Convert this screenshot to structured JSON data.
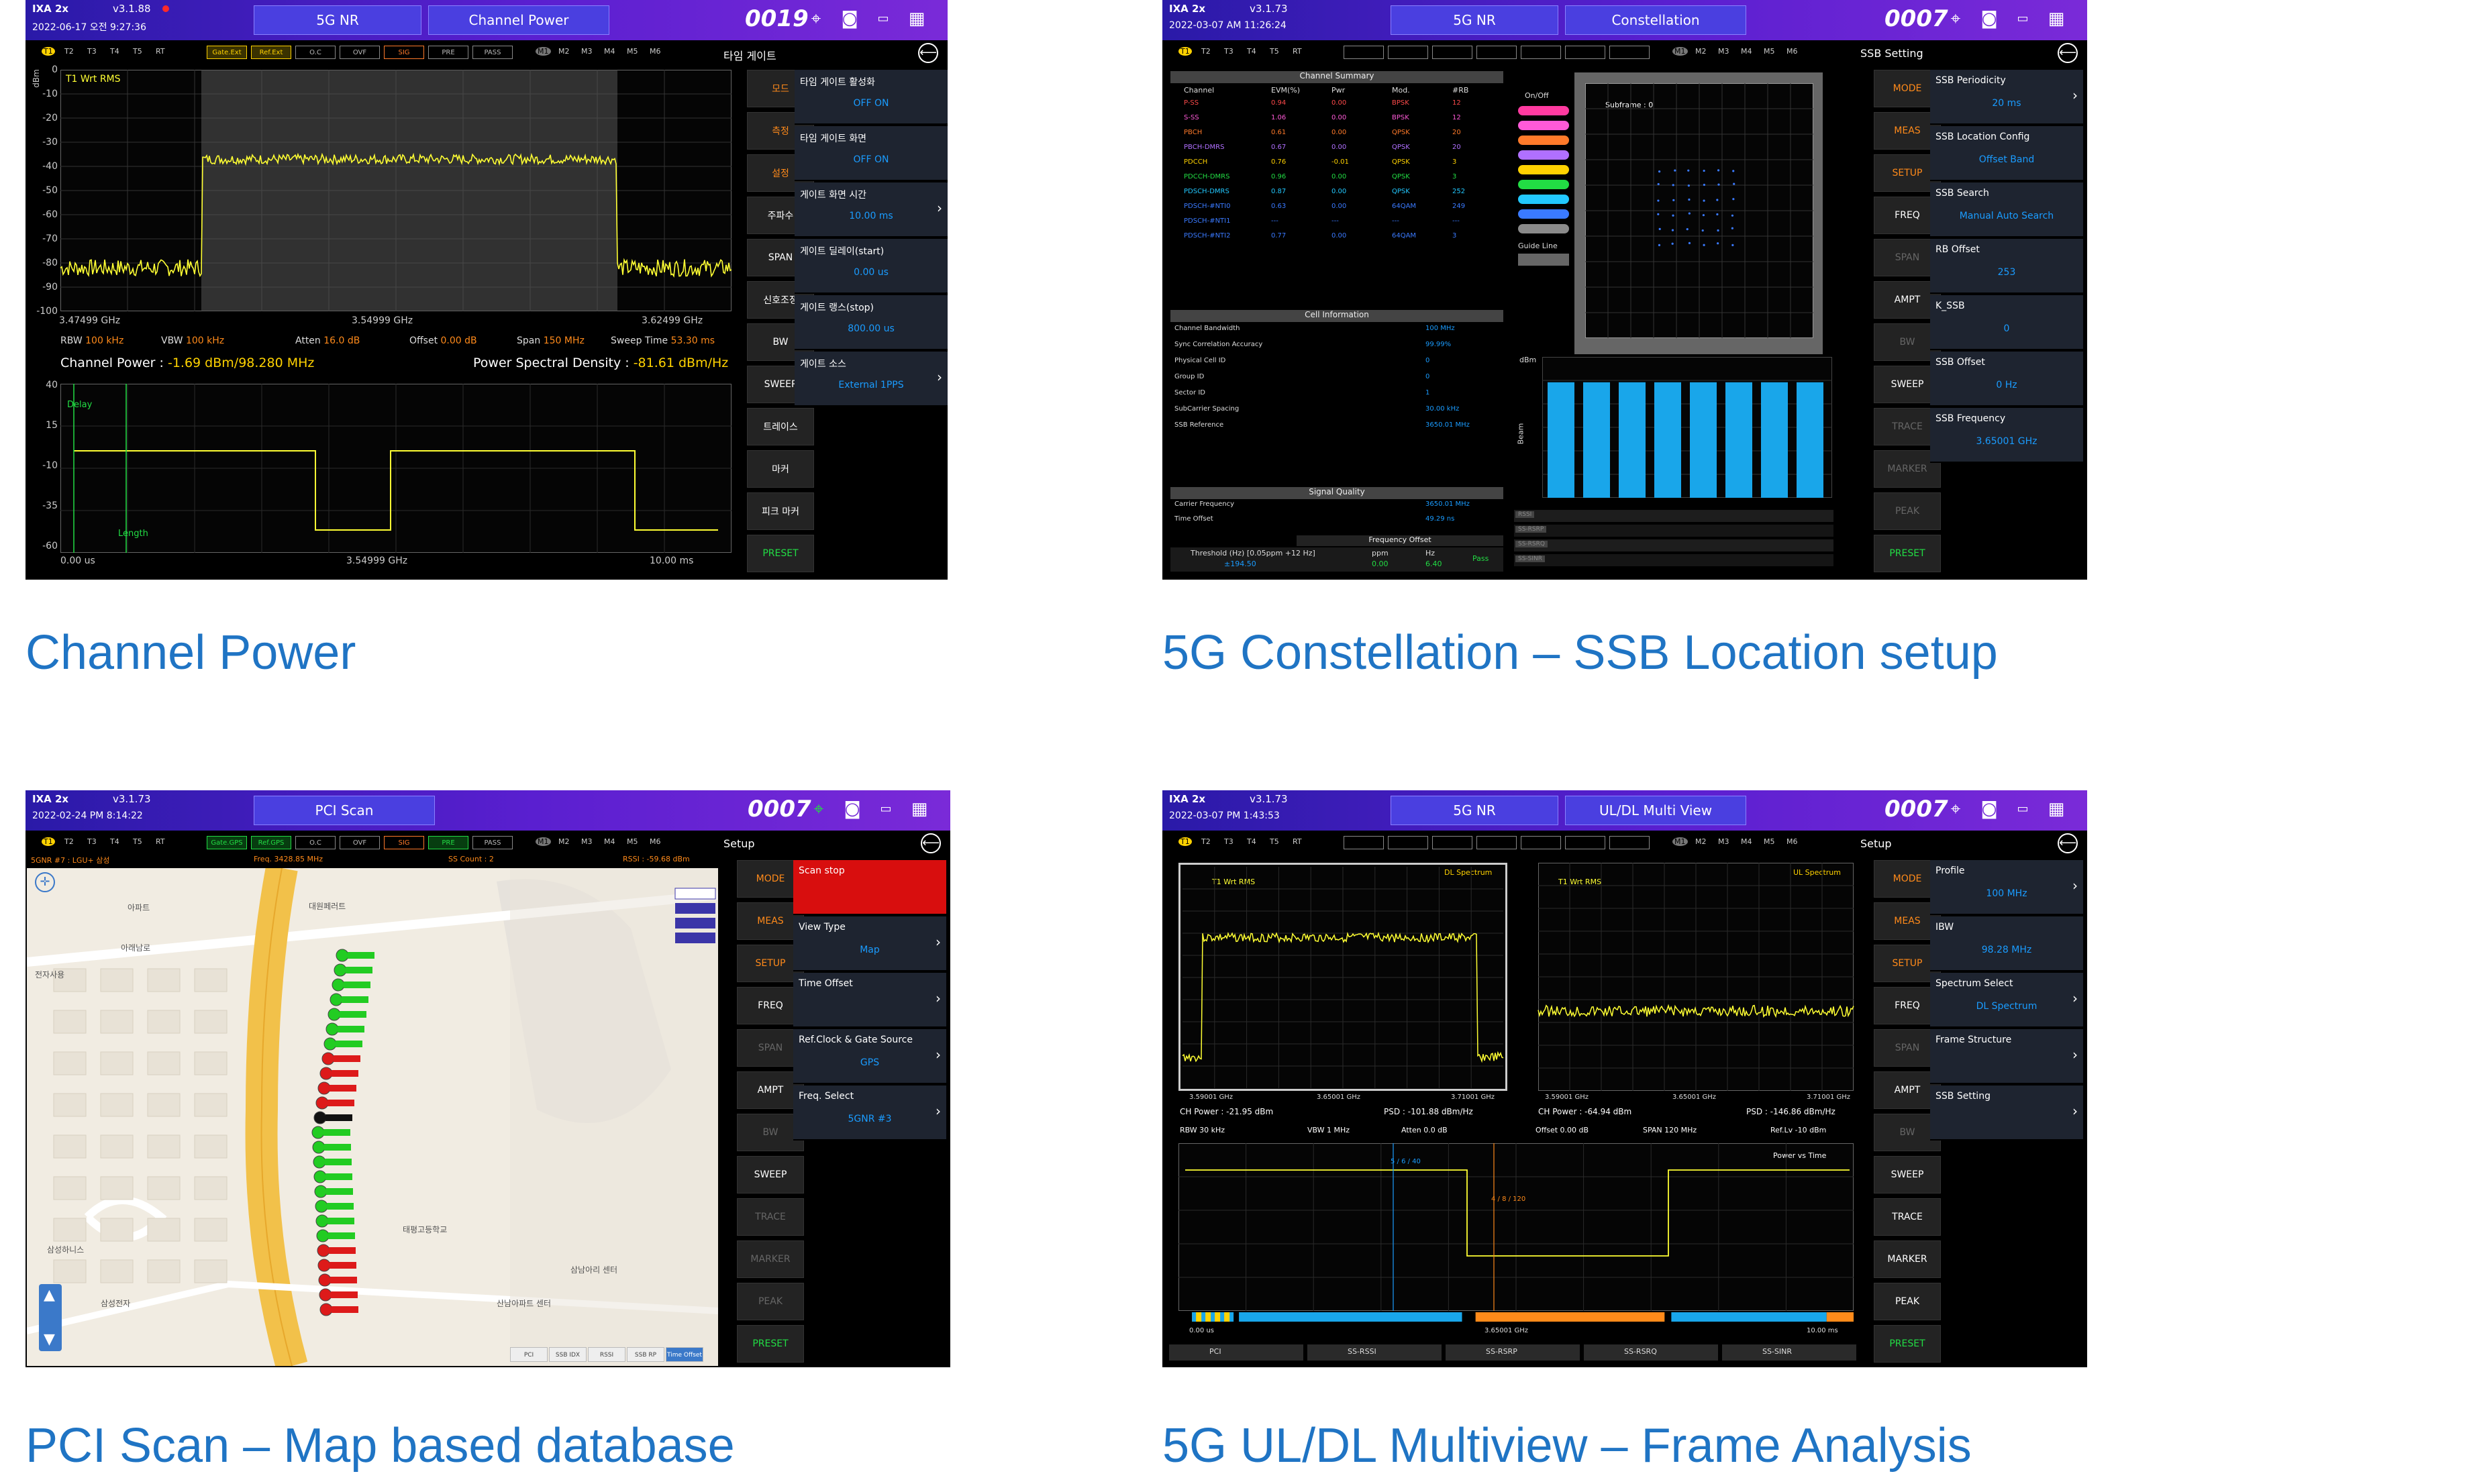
{
  "captions": {
    "p1": "Channel Power",
    "p2": "5G Constellation – SSB  Location setup",
    "p3": "PCI Scan – Map based database",
    "p4": "5G UL/DL Multiview – Frame Analysis"
  },
  "s1": {
    "device": "IXA 2x",
    "version": "v3.1.88",
    "datetime": "2022-06-17 오전 9:27:36",
    "tab_mode": "5G NR",
    "tab_meas": "Channel Power",
    "count": "0019",
    "traces": [
      "T1",
      "T2",
      "T3",
      "T4",
      "T5",
      "RT"
    ],
    "chips": [
      "Gate.Ext",
      "Ref.Ext",
      "O.C",
      "OVF",
      "SIG",
      "PRE",
      "PASS"
    ],
    "markers": [
      "M1",
      "M2",
      "M3",
      "M4",
      "M5",
      "M6"
    ],
    "panel_title": "타임 게이트",
    "trace_label": "T1 Wrt RMS",
    "y_unit": "dBm",
    "y_ticks": [
      "0",
      "-10",
      "-20",
      "-30",
      "-40",
      "-50",
      "-60",
      "-70",
      "-80",
      "-90",
      "-100"
    ],
    "x_start": "3.47499 GHz",
    "x_center": "3.54999 GHz",
    "x_stop": "3.62499 GHz",
    "rbw_l": "RBW",
    "rbw_v": "100 kHz",
    "vbw_l": "VBW",
    "vbw_v": "100 kHz",
    "atten_l": "Atten",
    "atten_v": "16.0 dB",
    "offset_l": "Offset",
    "offset_v": "0.00 dB",
    "span_l": "Span",
    "span_v": "150 MHz",
    "sweep_l": "Sweep Time",
    "sweep_v": "53.30 ms",
    "cp_label": "Channel Power : ",
    "cp_value": "-1.69 dBm/98.280 MHz",
    "psd_label": "Power Spectral Density : ",
    "psd_value": "-81.61 dBm/Hz",
    "y2_ticks": [
      "40",
      "15",
      "-10",
      "-35",
      "-60"
    ],
    "delay_label": "Delay",
    "length_label": "Length",
    "x2_start": "0.00 us",
    "x2_center": "3.54999 GHz",
    "x2_stop": "10.00 ms",
    "side": [
      "모드",
      "측정",
      "설정",
      "주파수",
      "SPAN",
      "신호조정",
      "BW",
      "SWEEP",
      "트레이스",
      "마커",
      "피크 마커",
      "PRESET"
    ],
    "panel": [
      {
        "t": "타임 게이트 활성화",
        "v": "OFF ON"
      },
      {
        "t": "타임 게이트 화면",
        "v": "OFF ON"
      },
      {
        "t": "게이트 화면 시간",
        "v": "10.00 ms"
      },
      {
        "t": "게이트 딜레이(start)",
        "v": "0.00 us"
      },
      {
        "t": "게이트 랭스(stop)",
        "v": "800.00 us"
      },
      {
        "t": "게이트 소스",
        "v": "External 1PPS"
      }
    ]
  },
  "s2": {
    "device": "IXA 2x",
    "version": "v3.1.73",
    "datetime": "2022-03-07 AM 11:26:24",
    "tab_mode": "5G NR",
    "tab_meas": "Constellation",
    "count": "0007",
    "traces": [
      "T1",
      "T2",
      "T3",
      "T4",
      "T5",
      "RT"
    ],
    "markers": [
      "M1",
      "M2",
      "M3",
      "M4",
      "M5",
      "M6"
    ],
    "panel_title": "SSB Setting",
    "summary_title": "Channel Summary",
    "summary_cols": [
      "Channel",
      "EVM(%)",
      "Pwr",
      "Mod.",
      "#RB"
    ],
    "summary_rows": [
      [
        "P-SS",
        "0.94",
        "0.00",
        "BPSK",
        "12"
      ],
      [
        "S-SS",
        "1.06",
        "0.00",
        "BPSK",
        "12"
      ],
      [
        "PBCH",
        "0.61",
        "0.00",
        "QPSK",
        "20"
      ],
      [
        "PBCH-DMRS",
        "0.67",
        "0.00",
        "QPSK",
        "20"
      ],
      [
        "PDCCH",
        "0.76",
        "-0.01",
        "QPSK",
        "3"
      ],
      [
        "PDCCH-DMRS",
        "0.96",
        "0.00",
        "QPSK",
        "3"
      ],
      [
        "PDSCH-DMRS",
        "0.87",
        "0.00",
        "QPSK",
        "252"
      ],
      [
        "PDSCH-#NTI0",
        "0.63",
        "0.00",
        "64QAM",
        "249"
      ],
      [
        "PDSCH-#NTI1",
        "---",
        "---",
        "---",
        "---"
      ],
      [
        "PDSCH-#NTI2",
        "0.77",
        "0.00",
        "64QAM",
        "3"
      ]
    ],
    "onoff": "On/Off",
    "guide_line": "Guide Line",
    "subframe": "Subframe : 0",
    "cell_title": "Cell Information",
    "cell_rows": [
      [
        "Channel Bandwidth",
        "100 MHz"
      ],
      [
        "Sync Correlation Accuracy",
        "99.99%"
      ],
      [
        "Physical Cell ID",
        "0"
      ],
      [
        "Group ID",
        "0"
      ],
      [
        "Sector ID",
        "1"
      ],
      [
        "SubCarrier Spacing",
        "30.00 kHz"
      ],
      [
        "SSB Reference",
        "3650.01 MHz"
      ]
    ],
    "sq_title": "Signal Quality",
    "sq_rows": [
      [
        "Carrier Frequency",
        "3650.01 MHz"
      ],
      [
        "Time Offset",
        "49.29 ns"
      ]
    ],
    "fo_title": "Frequency Offset",
    "fo_threshold": "Threshold (Hz) [0.05ppm +12 Hz]",
    "fo_ppm": "ppm",
    "fo_hz": "Hz",
    "fo_value": "±194.50",
    "fo_ppm_v": "0.00",
    "fo_hz_v": "6.40",
    "fo_pass": "Pass",
    "bar_values": [
      0.82,
      0.82,
      0.82,
      0.82,
      0.82,
      0.82,
      0.82,
      0.82
    ],
    "bars_unit": "dBm",
    "bars_axis": "Beam",
    "side": [
      "MODE",
      "MEAS",
      "SETUP",
      "FREQ",
      "SPAN",
      "AMPT",
      "BW",
      "SWEEP",
      "TRACE",
      "MARKER",
      "PEAK",
      "PRESET"
    ],
    "panel": [
      {
        "t": "SSB Periodicity",
        "v": "20 ms",
        "c": true
      },
      {
        "t": "SSB Location Config",
        "v": "Offset Band",
        "c": false
      },
      {
        "t": "SSB Search",
        "v": "Manual Auto Search",
        "c": false
      },
      {
        "t": "RB Offset",
        "v": "253",
        "c": false
      },
      {
        "t": "K_SSB",
        "v": "0",
        "c": false
      },
      {
        "t": "SSB Offset",
        "v": "0 Hz",
        "c": false
      },
      {
        "t": "SSB Frequency",
        "v": "3.65001 GHz",
        "c": false
      }
    ],
    "bottom_rows": [
      "RSSI",
      "SS-RSRP",
      "SS-RSRQ",
      "SS-SINR"
    ]
  },
  "s3": {
    "device": "IXA 2x",
    "version": "v3.1.73",
    "datetime": "2022-02-24 PM 8:14:22",
    "tab_meas": "PCI Scan",
    "count": "0007",
    "traces": [
      "T1",
      "T2",
      "T3",
      "T4",
      "T5",
      "RT"
    ],
    "chips": [
      "Gate.GPS",
      "Ref.GPS",
      "O.C",
      "OVF",
      "SIG",
      "PRE",
      "PASS"
    ],
    "markers": [
      "M1",
      "M2",
      "M3",
      "M4",
      "M5",
      "M6"
    ],
    "panel_title": "Setup",
    "info_left": "5GNR #7 : LGU+ 삼성",
    "info_freq": "Freq. 3428.85 MHz",
    "info_ss": "SS Count : 2",
    "info_rssi": "RSSI : -59.68 dBm",
    "map_labels": [
      "아파트",
      "대원페러트",
      "아래남로",
      "전자사용",
      "태평고등학교",
      "삼성전자",
      "산남아파트 센터",
      "삼성하니스",
      "삼남아리 센터"
    ],
    "map_tabs": [
      "PCI",
      "SSB IDX",
      "RSSI",
      "SSB RP",
      "Time Offset"
    ],
    "side": [
      "MODE",
      "MEAS",
      "SETUP",
      "FREQ",
      "SPAN",
      "AMPT",
      "BW",
      "SWEEP",
      "TRACE",
      "MARKER",
      "PEAK",
      "PRESET"
    ],
    "panel": [
      {
        "t": "Scan stop",
        "v": "",
        "c": false,
        "red": true
      },
      {
        "t": "View Type",
        "v": "Map",
        "c": true
      },
      {
        "t": "Time Offset",
        "v": "",
        "c": true
      },
      {
        "t": "Ref.Clock & Gate Source",
        "v": "GPS",
        "c": true
      },
      {
        "t": "Freq. Select",
        "v": "5GNR #3",
        "c": true
      }
    ]
  },
  "s4": {
    "device": "IXA 2x",
    "version": "v3.1.73",
    "datetime": "2022-03-07 PM 1:43:53",
    "tab_mode": "5G NR",
    "tab_meas": "UL/DL Multi View",
    "count": "0007",
    "traces": [
      "T1",
      "T2",
      "T3",
      "T4",
      "T5",
      "RT"
    ],
    "markers": [
      "M1",
      "M2",
      "M3",
      "M4",
      "M5",
      "M6"
    ],
    "panel_title": "Setup",
    "trace_label": "T1 Wrt RMS",
    "dl_title": "DL Spectrum",
    "ul_title": "UL Spectrum",
    "x_start": "3.59001 GHz",
    "x_center": "3.65001 GHz",
    "x_stop": "3.71001 GHz",
    "dl_power": "CH Power : -21.95 dBm",
    "dl_psd": "PSD : -101.88 dBm/Hz",
    "ul_power": "CH Power : -64.94 dBm",
    "ul_psd": "PSD : -146.86 dBm/Hz",
    "rbw": "RBW 30 kHz",
    "vbw": "VBW 1 MHz",
    "atten": "Atten 0.0 dB",
    "offset": "Offset 0.00 dB",
    "span": "SPAN 120 MHz",
    "ref": "Ref.Lv -10 dBm",
    "pvt_title": "Power vs Time",
    "marker1": "5 / 6 / 40",
    "marker2": "4 / 8 / 120",
    "pvt_x_start": "0.00 us",
    "pvt_x_center": "3.65001 GHz",
    "pvt_x_stop": "10.00 ms",
    "bottom": [
      "PCI",
      "SS-RSSI",
      "SS-RSRP",
      "SS-RSRQ",
      "SS-SINR"
    ],
    "side": [
      "MODE",
      "MEAS",
      "SETUP",
      "FREQ",
      "SPAN",
      "AMPT",
      "BW",
      "SWEEP",
      "TRACE",
      "MARKER",
      "PEAK",
      "PRESET"
    ],
    "panel": [
      {
        "t": "Profile",
        "v": "100 MHz",
        "c": true
      },
      {
        "t": "IBW",
        "v": "98.28 MHz",
        "c": false
      },
      {
        "t": "Spectrum Select",
        "v": "DL Spectrum",
        "c": true
      },
      {
        "t": "Frame Structure",
        "v": "",
        "c": true
      },
      {
        "t": "SSB Setting",
        "v": "",
        "c": true
      }
    ]
  },
  "colors": {
    "caption": "#1f74c4",
    "trace": "#ffff33",
    "accent": "#ff8a1a",
    "value": "#1a9cff",
    "bar": "#19a6ea"
  }
}
